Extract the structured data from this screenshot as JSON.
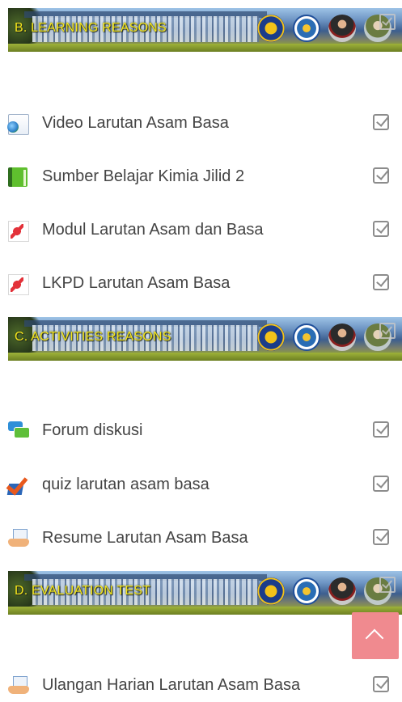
{
  "sections": [
    {
      "title": "B. LEARNING REASONS",
      "items": [
        {
          "label": "Video Larutan Asam Basa",
          "icon": "url-globe-icon"
        },
        {
          "label": "Sumber Belajar Kimia Jilid 2",
          "icon": "book-icon"
        },
        {
          "label": "Modul Larutan Asam dan Basa",
          "icon": "pdf-icon"
        },
        {
          "label": "LKPD Larutan Asam Basa",
          "icon": "pdf-icon"
        }
      ]
    },
    {
      "title": "C. ACTIVITIES REASONS",
      "items": [
        {
          "label": "Forum diskusi",
          "icon": "forum-icon"
        },
        {
          "label": "quiz larutan asam basa",
          "icon": "quiz-icon"
        },
        {
          "label": "Resume Larutan Asam Basa",
          "icon": "assignment-icon"
        }
      ]
    },
    {
      "title": "D. EVALUATION TEST",
      "items": [
        {
          "label": "Ulangan Harian Larutan Asam Basa",
          "icon": "assignment-icon"
        }
      ]
    }
  ],
  "colors": {
    "banner_title": "#f5e51c",
    "label_text": "#444444",
    "checkbox": "#8c8c8c",
    "scroll_top_button": "#f08a8f"
  },
  "scroll_top_icon": "chevron-up-icon"
}
